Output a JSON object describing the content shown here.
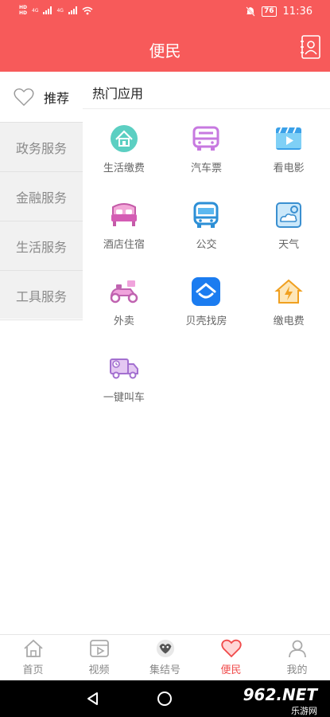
{
  "status": {
    "time": "11:36",
    "battery": "76",
    "hd1": "HD",
    "hd2": "HD",
    "net1": "4G",
    "net2": "4G"
  },
  "header": {
    "title": "便民"
  },
  "sidebar": {
    "items": [
      {
        "label": "推荐"
      },
      {
        "label": "政务服务"
      },
      {
        "label": "金融服务"
      },
      {
        "label": "生活服务"
      },
      {
        "label": "工具服务"
      }
    ]
  },
  "main": {
    "section_title": "热门应用",
    "apps": [
      {
        "label": "生活缴费",
        "icon": "house-icon"
      },
      {
        "label": "汽车票",
        "icon": "bus-icon"
      },
      {
        "label": "看电影",
        "icon": "movie-icon"
      },
      {
        "label": "酒店住宿",
        "icon": "bed-icon"
      },
      {
        "label": "公交",
        "icon": "bus-front-icon"
      },
      {
        "label": "天气",
        "icon": "weather-icon"
      },
      {
        "label": "外卖",
        "icon": "scooter-icon"
      },
      {
        "label": "贝壳找房",
        "icon": "beike-icon"
      },
      {
        "label": "缴电费",
        "icon": "electric-icon"
      },
      {
        "label": "一键叫车",
        "icon": "truck-icon"
      }
    ]
  },
  "bottom_nav": {
    "items": [
      {
        "label": "首页"
      },
      {
        "label": "视频"
      },
      {
        "label": "集结号"
      },
      {
        "label": "便民"
      },
      {
        "label": "我的"
      }
    ]
  },
  "watermark": {
    "text": "962.NET",
    "sub": "乐游网"
  },
  "colors": {
    "accent": "#f75a5a",
    "active_nav": "#f04a4a"
  }
}
